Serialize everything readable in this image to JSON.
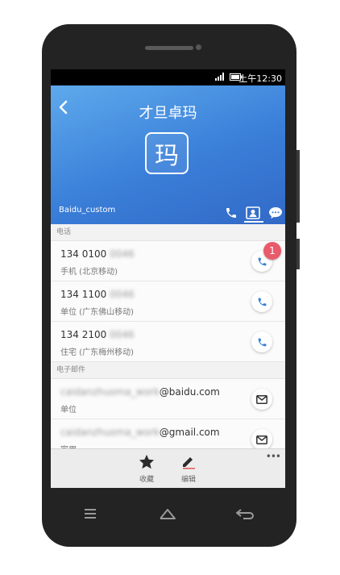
{
  "status_bar": {
    "time": "上午12:30"
  },
  "header": {
    "title": "才旦卓玛",
    "avatar_char": "玛",
    "account": "Baidu_custom"
  },
  "phone_section": {
    "header": "电话",
    "entries": [
      {
        "number_visible": "134 0100",
        "number_hidden": "0046",
        "label": "手机 (北京移动)"
      },
      {
        "number_visible": "134 1100",
        "number_hidden": "0046",
        "label": "单位 (广东佛山移动)"
      },
      {
        "number_visible": "134 2100",
        "number_hidden": "0046",
        "label": "住宅 (广东梅州移动)"
      }
    ],
    "badge": "1"
  },
  "email_section": {
    "header": "电子邮件",
    "entries": [
      {
        "local_hidden": "caidanzhuoma_work",
        "domain": "@baidu.com",
        "label": "单位"
      },
      {
        "local_hidden": "caidanzhuoma_work",
        "domain": "@gmail.com",
        "label": "家用"
      }
    ]
  },
  "bottom_bar": {
    "favorite": "收藏",
    "edit": "编辑",
    "more": "•••"
  },
  "colors": {
    "header_blue": "#3a7fd9",
    "badge": "#e95a6a",
    "action_icon": "#2f7fd8"
  }
}
